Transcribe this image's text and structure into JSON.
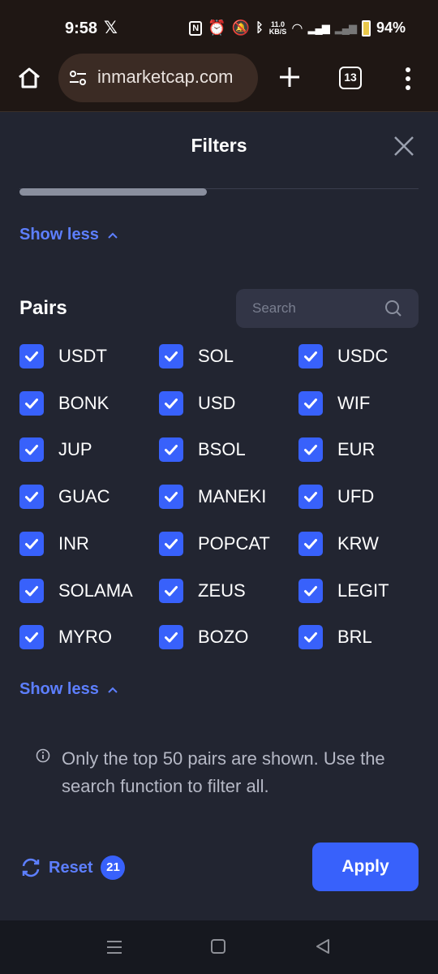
{
  "status_bar": {
    "time": "9:58",
    "x_app": "𝕏",
    "network_speed_top": "11.0",
    "network_speed_unit": "KB/S",
    "battery": "94%"
  },
  "browser": {
    "url": "inmarketcap.com",
    "tab_count": "13"
  },
  "filters": {
    "title": "Filters",
    "show_less_top": "Show less",
    "pairs_label": "Pairs",
    "search_placeholder": "Search",
    "pairs": [
      {
        "label": "USDT",
        "checked": true
      },
      {
        "label": "SOL",
        "checked": true
      },
      {
        "label": "USDC",
        "checked": true
      },
      {
        "label": "BONK",
        "checked": true
      },
      {
        "label": "USD",
        "checked": true
      },
      {
        "label": "WIF",
        "checked": true
      },
      {
        "label": "JUP",
        "checked": true
      },
      {
        "label": "BSOL",
        "checked": true
      },
      {
        "label": "EUR",
        "checked": true
      },
      {
        "label": "GUAC",
        "checked": true
      },
      {
        "label": "MANEKI",
        "checked": true
      },
      {
        "label": "UFD",
        "checked": true
      },
      {
        "label": "INR",
        "checked": true
      },
      {
        "label": "POPCAT",
        "checked": true
      },
      {
        "label": "KRW",
        "checked": true
      },
      {
        "label": "SOLAMA",
        "checked": true
      },
      {
        "label": "ZEUS",
        "checked": true
      },
      {
        "label": "LEGIT",
        "checked": true
      },
      {
        "label": "MYRO",
        "checked": true
      },
      {
        "label": "BOZO",
        "checked": true
      },
      {
        "label": "BRL",
        "checked": true
      }
    ],
    "show_less_bottom": "Show less",
    "info_text": "Only the top 50 pairs are shown. Use the search function to filter all.",
    "reset_label": "Reset",
    "reset_count": "21",
    "apply_label": "Apply"
  },
  "colors": {
    "accent": "#3861fb",
    "link": "#5d7fff",
    "panel_bg": "#222531",
    "browser_bg": "#1f1714"
  }
}
